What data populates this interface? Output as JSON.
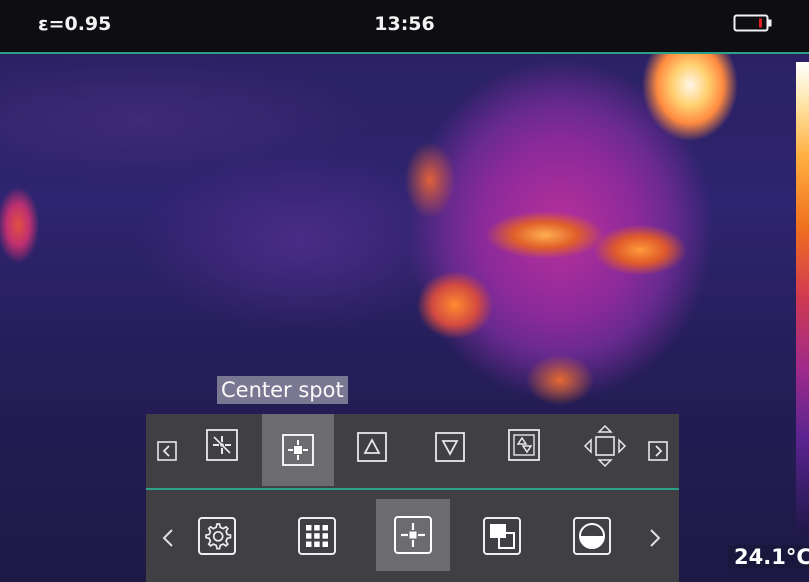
{
  "status_bar": {
    "emissivity": "ε=0.95",
    "time": "13:56",
    "battery_icon": "battery-low-icon"
  },
  "viewport": {
    "spot_label": "Center spot",
    "temperature": "24.1°C"
  },
  "measure_toolbar": {
    "items": [
      {
        "name": "scroll-left-icon"
      },
      {
        "name": "crosshair-icon"
      },
      {
        "name": "center-spot-icon",
        "selected": true
      },
      {
        "name": "hot-spot-icon"
      },
      {
        "name": "cold-spot-icon"
      },
      {
        "name": "hot-cold-spot-icon"
      },
      {
        "name": "move-spot-icon"
      },
      {
        "name": "scroll-right-icon"
      }
    ]
  },
  "main_toolbar": {
    "items": [
      {
        "name": "prev-icon"
      },
      {
        "name": "settings-icon"
      },
      {
        "name": "grid-icon"
      },
      {
        "name": "measure-spot-icon",
        "selected": true
      },
      {
        "name": "picture-in-picture-icon"
      },
      {
        "name": "palette-icon"
      },
      {
        "name": "next-icon"
      }
    ]
  },
  "colors": {
    "accent": "#2aa389",
    "panel": "#3f3f44",
    "selected": "#6b6b70",
    "battery_warning": "#e02020"
  }
}
